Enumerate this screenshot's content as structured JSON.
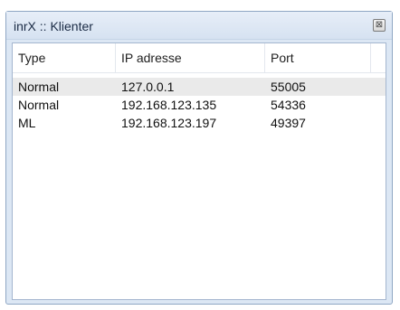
{
  "window": {
    "title": "inrX :: Klienter",
    "close_glyph": "⊠",
    "accent": "#dce7f4"
  },
  "list": {
    "columns": [
      "Type",
      "IP adresse",
      "Port"
    ],
    "rows": [
      {
        "type": "Normal",
        "ip": "127.0.0.1",
        "port": "55005",
        "selected": true
      },
      {
        "type": "Normal",
        "ip": "192.168.123.135",
        "port": "54336",
        "selected": false
      },
      {
        "type": "ML",
        "ip": "192.168.123.197",
        "port": "49397",
        "selected": false
      }
    ]
  }
}
